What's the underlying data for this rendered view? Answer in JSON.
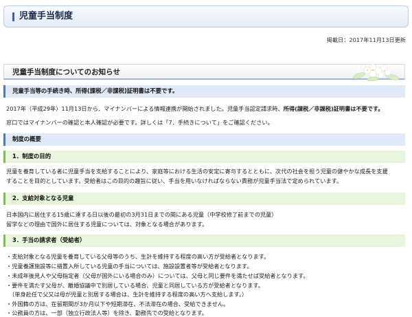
{
  "header": {
    "title": "児童手当制度"
  },
  "posted_date": "掲載日：2017年11月13日更新",
  "notice": {
    "title": "児童手当制度についてのお知らせ"
  },
  "banner": {
    "heading": "児童手当等の手続き時、所得(課税／非課税)証明書は不要です。",
    "line1_prefix": "2017年（平成29年）11月13日から、マイナンバーによる情報連携が開始されました。児童手当認定請求時、",
    "line1_strong": "所得(課税／非課税)証明書は不要です。",
    "line2": "窓口ではマイナンバーの確認と本人確認が必要です。詳しくは「7．手続きについて」をご確認ください。"
  },
  "overview": {
    "heading": "制度の概要",
    "sections": [
      {
        "heading": "1．制度の目的",
        "lines": [
          "児童を養育している者に児童手当を支給することにより、家庭等における生活の安定に寄与するとともに、次代の社会を担う児童の健やかな成長を支援",
          "することを目的としています。受給者はこの目的の趣旨に従い、手当を用いなければならない責務が児童手当法で定められています。"
        ]
      },
      {
        "heading": "2．支給対象となる児童",
        "lines": [
          "日本国内に居住する15歳に達する日以後の最初の3月31日までの間にある児童（中学校修了前までの児童）",
          "留学などの理由で国外に居住する児童については、対象となる場合があります。"
        ]
      },
      {
        "heading": "3．手当の請求者（受給者）",
        "lines": [
          "・支給対象となる児童を養育している父母等のうち、生計を維持する程度の高い方が受給者となります。",
          "・児童養護施設等に措置入所している児童の手当については、施設設置者等が受給者となります。",
          "・未成年後見人や父母指定者（父母が国外にいる場合のみ）については、父母と同じ要件を満たせば受給者となります。",
          "・要件を満たす父母が、離婚協議中で別居している場合、児童と同居している方が受給者となります。",
          "　（単身赴任で父又は母が児童と別居する場合は、生計を維持する程度の高い方へ支給します。）",
          "・外国籍の方は、在留期間が3か月以下や短期滞在、不法滞在の場合、受給できません。",
          "・公務員の方は、一部（独立行政法人等）を除き、勤務先での受給となります。"
        ]
      }
    ]
  }
}
